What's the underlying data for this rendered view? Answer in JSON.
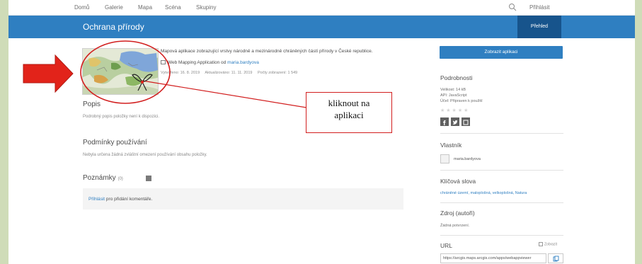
{
  "nav": {
    "items": [
      "Domů",
      "Galerie",
      "Mapa",
      "Scéna",
      "Skupiny"
    ],
    "login": "Přihlásit"
  },
  "banner": {
    "title": "Ochrana přírody",
    "tab_overview": "Přehled"
  },
  "item": {
    "description": "Mapová aplikace zobrazující vrstvy národně a mezinárodně chráněných částí přírody v České republice.",
    "type_prefix": "Web Mapping Application od",
    "owner_link": "maria.bardyova",
    "created": "Vytvořeno: 16. 8. 2019",
    "updated": "Aktualizováno: 11. 11. 2019",
    "views": "Počty zobrazení: 1 549"
  },
  "sections": {
    "popis_title": "Popis",
    "popis_text": "Podrobný popis položky není k dispozici.",
    "terms_title": "Podmínky používání",
    "terms_text": "Nebyla určena žádná zvláštní omezení používání obsahu položky.",
    "comments_title": "Poznámky",
    "comments_count": "(0)",
    "comments_link": "Přihlásit",
    "comments_rest": " pro přidání komentáře."
  },
  "sidebar": {
    "open_button": "Zobrazit aplikaci",
    "details_title": "Podrobnosti",
    "size": "Velikost: 14 kB",
    "api": "API: JavaScript",
    "purpose": "Účel: Připraven k použití",
    "stars": "★★★★★",
    "owner_title": "Vlastník",
    "owner_name": "maria.bardyova",
    "keywords_title": "Klíčová slova",
    "keywords": "chráněné území, maloplošná, velkoplošná, Natura",
    "source_title": "Zdroj (autoři)",
    "source_text": "Žádná potvrzení.",
    "url_title": "URL",
    "url_view": "Zobrazit",
    "url_value": "https://arcgis.maps.arcgis.com/apps/webappviewer"
  },
  "annotation": {
    "line1": "kliknout na",
    "line2": "aplikaci"
  },
  "colors": {
    "accent": "#2f7fc1",
    "banner_tab": "#17548c",
    "annotation_red": "#d21f1f"
  }
}
